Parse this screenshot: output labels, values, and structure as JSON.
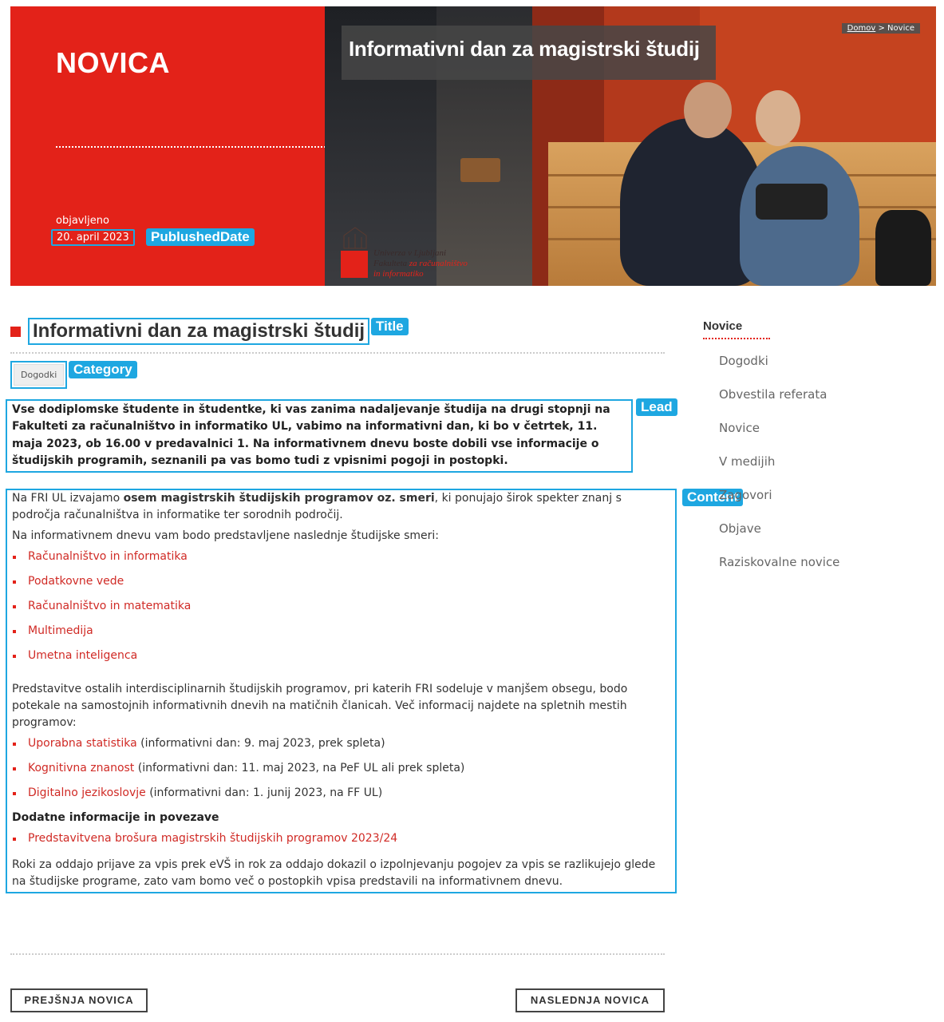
{
  "hero": {
    "section_label": "NOVICA",
    "published_label": "objavljeno",
    "published_date": "20. april 2023",
    "published_tag": "PublushedDate",
    "headline": "Informativni dan za magistrski študij",
    "breadcrumb": {
      "home": "Domov",
      "separator": ">",
      "current": "Novice"
    },
    "university_logo": {
      "line1_a": "Univerza",
      "line1_b": "v Ljubljani",
      "line2_a": "Fakulteta",
      "line2_b": "za računalništvo",
      "line3": "in informatiko"
    }
  },
  "article": {
    "title": "Informativni dan za magistrski študij",
    "title_tag": "Title",
    "category": "Dogodki",
    "category_tag": "Category",
    "lead_tag": "Lead",
    "lead": "Vse dodiplomske študente in študentke, ki vas zanima nadaljevanje študija na drugi stopnji na Fakulteti za računalništvo in informatiko UL, vabimo na informativni dan, ki bo v četrtek, 11. maja 2023, ob 16.00 v predavalnici 1. Na informativnem dnevu boste dobili vse informacije o študijskih programih, seznanili pa vas bomo tudi z vpisnimi pogoji in postopki.",
    "content_tag": "Content",
    "intro_a": "Na FRI UL izvajamo ",
    "intro_b": "osem magistrskih študijskih programov oz. smeri",
    "intro_c": ", ki ponujajo širok spekter znanj s področja računalništva in informatike ter sorodnih področij.",
    "programs_intro": "Na informativnem dnevu vam bodo predstavljene naslednje študijske smeri:",
    "programs": [
      "Računalništvo in informatika",
      "Podatkovne vede",
      "Računalništvo in matematika",
      "Multimedija",
      "Umetna inteligenca"
    ],
    "interdisciplinary_text": "Predstavitve ostalih interdisciplinarnih študijskih programov, pri katerih FRI sodeluje v manjšem obsegu, bodo potekale na samostojnih informativnih dnevih na matičnih članicah. Več informacij najdete na spletnih mestih programov:",
    "interdisciplinary": [
      {
        "link": "Uporabna statistika",
        "note": " (informativni dan: 9. maj 2023, prek spleta)"
      },
      {
        "link": "Kognitivna znanost",
        "note": " (informativni dan: 11. maj 2023, na PeF UL ali prek spleta)"
      },
      {
        "link": "Digitalno jezikoslovje",
        "note": " (informativni dan: 1. junij 2023, na FF UL)"
      }
    ],
    "extra_heading": "Dodatne informacije in povezave",
    "extra_link": "Predstavitvena brošura magistrskih študijskih programov 2023/24",
    "closing": "Roki za oddajo prijave za vpis prek eVŠ in rok za oddajo dokazil o izpolnjevanju pogojev za vpis se razlikujejo glede na študijske programe, zato vam bomo več o postopkih vpisa predstavili na informativnem dnevu."
  },
  "pagination": {
    "prev": "PREJŠNJA NOVICA",
    "next": "NASLEDNJA NOVICA"
  },
  "sidebar": {
    "heading": "Novice",
    "items": [
      "Dogodki",
      "Obvestila referata",
      "Novice",
      "V medijih",
      "Zagovori",
      "Objave",
      "Raziskovalne novice"
    ]
  },
  "colors": {
    "accent": "#e32219",
    "annotation": "#1ea7e1",
    "link": "#d02a25"
  }
}
